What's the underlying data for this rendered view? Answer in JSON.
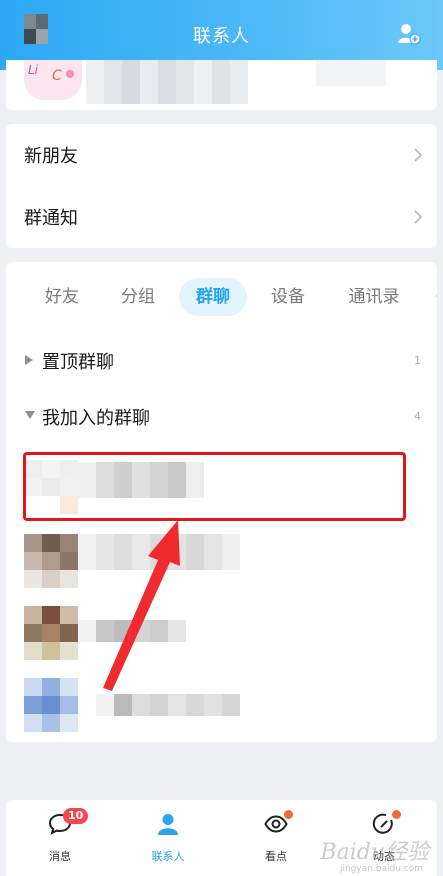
{
  "header": {
    "title": "联系人",
    "add_friend_icon": "add-friend-icon"
  },
  "entries": {
    "new_friends": "新朋友",
    "group_notice": "群通知"
  },
  "tabs": [
    {
      "label": "好友",
      "active": false
    },
    {
      "label": "分组",
      "active": false
    },
    {
      "label": "群聊",
      "active": true
    },
    {
      "label": "设备",
      "active": false
    },
    {
      "label": "通讯录",
      "active": false
    }
  ],
  "groups": {
    "pinned": {
      "label": "置顶群聊",
      "count": "1"
    },
    "joined": {
      "label": "我加入的群聊",
      "count": "4"
    }
  },
  "tabbar": {
    "messages": {
      "label": "消息",
      "badge": "10"
    },
    "contacts": {
      "label": "联系人"
    },
    "watch": {
      "label": "看点"
    },
    "moments": {
      "label": "动态"
    }
  },
  "watermark": {
    "text": "Baidu经验",
    "sub": "jingyan.baidu.com"
  },
  "colors": {
    "header_start": "#2ea8f5",
    "accent": "#24a4ee",
    "highlight_border": "#e4141b",
    "badge": "#f2474c"
  }
}
